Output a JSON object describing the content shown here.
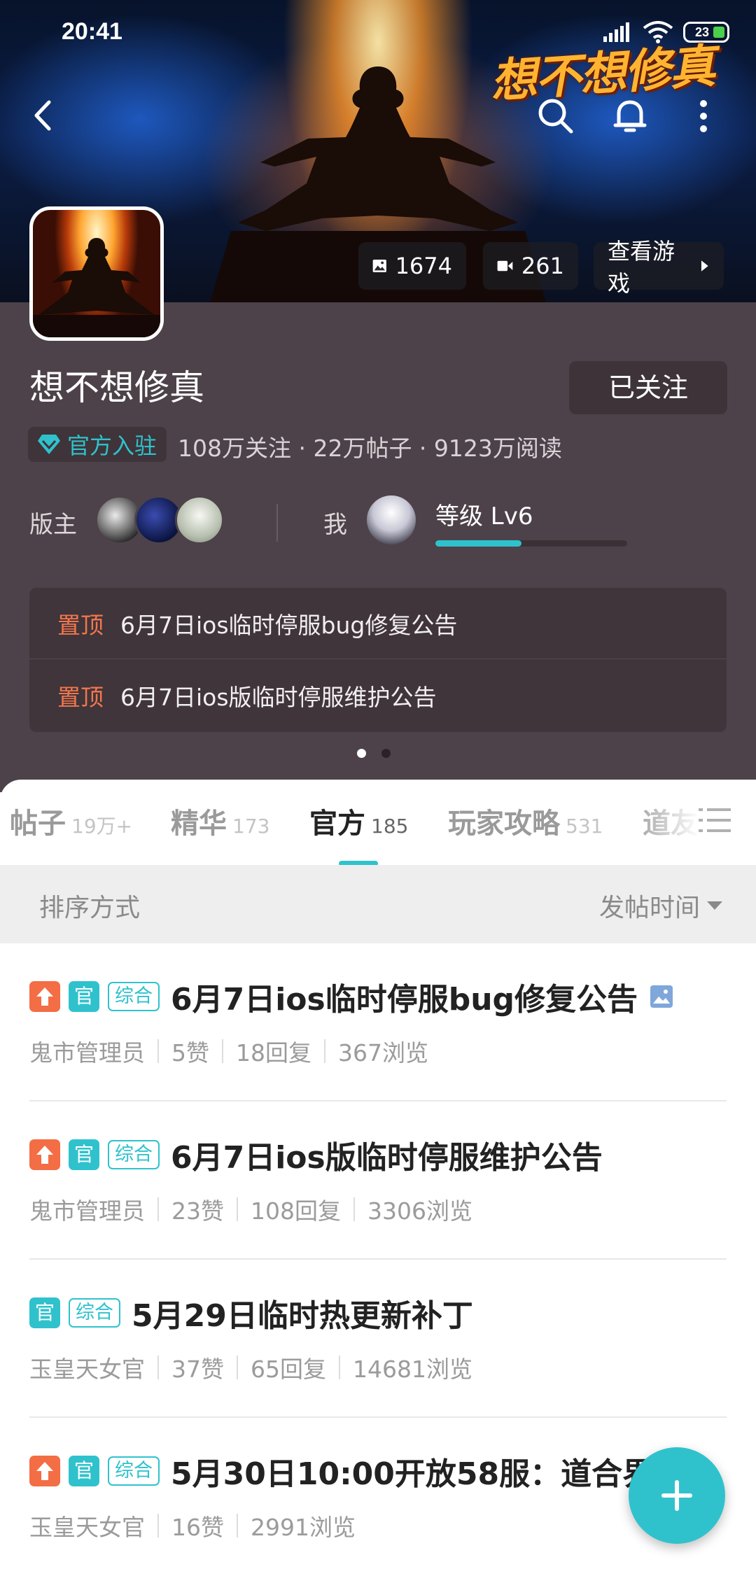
{
  "status_bar": {
    "time": "20:41",
    "battery": "23"
  },
  "header": {
    "game_logo_text": "想不想修真"
  },
  "media_stats": {
    "images": "1674",
    "videos": "261",
    "view_game_label": "查看游戏"
  },
  "forum": {
    "title": "想不想修真",
    "follow_label": "已关注",
    "official_badge": "官方入驻",
    "stats": "108万关注 · 22万帖子 · 9123万阅读"
  },
  "moderator": {
    "label": "版主",
    "avatars": [
      "moderator-1",
      "moderator-2",
      "moderator-3"
    ]
  },
  "me": {
    "label": "我",
    "level": "等级 Lv6",
    "level_progress": 0.45
  },
  "pinned": [
    {
      "tag": "置顶",
      "title": "6月7日ios临时停服bug修复公告"
    },
    {
      "tag": "置顶",
      "title": "6月7日ios版临时停服维护公告"
    }
  ],
  "pager": {
    "pages": 2,
    "active": 0
  },
  "tabs": [
    {
      "name": "帖子",
      "count": "19万+"
    },
    {
      "name": "精华",
      "count": "173"
    },
    {
      "name": "官方",
      "count": "185",
      "active": true
    },
    {
      "name": "玩家攻略",
      "count": "531"
    },
    {
      "name": "道友",
      "count": ""
    }
  ],
  "sort": {
    "label": "排序方式",
    "value": "发帖时间"
  },
  "posts": [
    {
      "tags": [
        "up",
        "官",
        "综合"
      ],
      "title": "6月7日ios临时停服bug修复公告",
      "has_image": true,
      "author": "鬼市管理员",
      "likes": "5赞",
      "replies": "18回复",
      "views": "367浏览"
    },
    {
      "tags": [
        "up",
        "官",
        "综合"
      ],
      "title": "6月7日ios版临时停服维护公告",
      "has_image": false,
      "author": "鬼市管理员",
      "likes": "23赞",
      "replies": "108回复",
      "views": "3306浏览"
    },
    {
      "tags": [
        "官",
        "综合"
      ],
      "title": "5月29日临时热更新补丁",
      "has_image": false,
      "author": "玉皇天女官",
      "likes": "37赞",
      "replies": "65回复",
      "views": "14681浏览"
    },
    {
      "tags": [
        "up",
        "官",
        "综合"
      ],
      "title": "5月30日10:00开放58服：道合界",
      "has_image": false,
      "author": "玉皇天女官",
      "likes": "16赞",
      "replies": "",
      "views": "2991浏览"
    }
  ],
  "colors": {
    "accent": "#2fc2cd",
    "pin": "#f3764d",
    "panel": "#4d4249",
    "up_tag": "#f36d45"
  }
}
